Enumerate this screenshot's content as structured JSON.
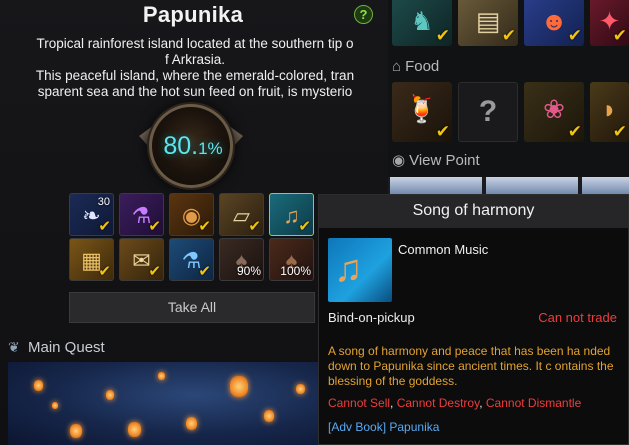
{
  "island": {
    "title": "Papunika",
    "help_label": "?",
    "description": "Tropical rainforest island located at the southern tip o\nf Arkrasia.\nThis peaceful island, where the emerald-colored, tran\nsparent sea and the hot sun feed on fruit, is mysterio",
    "completion_main": "80.",
    "completion_frac": "1%"
  },
  "rewards": {
    "row1": [
      {
        "icon": "feather-icon",
        "qty": "30"
      },
      {
        "icon": "potion-purple-icon"
      },
      {
        "icon": "drum-icon"
      },
      {
        "icon": "map-scroll-icon"
      },
      {
        "icon": "lute-icon"
      }
    ],
    "row2": [
      {
        "icon": "treasure-map-icon"
      },
      {
        "icon": "scroll-icon"
      },
      {
        "icon": "potion-blue-icon"
      },
      {
        "icon": "card-icon",
        "pct": "90%"
      },
      {
        "icon": "card-icon",
        "pct": "100%"
      }
    ],
    "take_all_label": "Take All"
  },
  "main_quest": {
    "label": "Main Quest"
  },
  "right_panel": {
    "top_icons": [
      "creature-icon",
      "map-icon",
      "mask-icon",
      "relic-icon"
    ],
    "food_label": "Food",
    "food_icons": [
      "cocktail-icon",
      "unknown-icon",
      "fruit-icon",
      "dumpling-icon"
    ],
    "unknown_glyph": "?",
    "view_point_label": "View Point"
  },
  "tooltip": {
    "title": "Song of harmony",
    "item_type": "Common Music",
    "bind": "Bind-on-pickup",
    "trade": "Can not trade",
    "description": "A song of harmony and peace that has been ha nded down to Papunika since ancient times. It c ontains the blessing of the goddess.",
    "cannot_sell": "Cannot Sell",
    "cannot_destroy": "Cannot Destroy",
    "cannot_dismantle": "Cannot Dismantle",
    "separator": ", ",
    "book": "[Adv Book] Papunika"
  },
  "colors": {
    "percent": "#5ee6ef",
    "check": "#f1c40f",
    "warning_red": "#f03c3c",
    "description_orange": "#e3a230",
    "link_blue": "#5aa9f0"
  }
}
